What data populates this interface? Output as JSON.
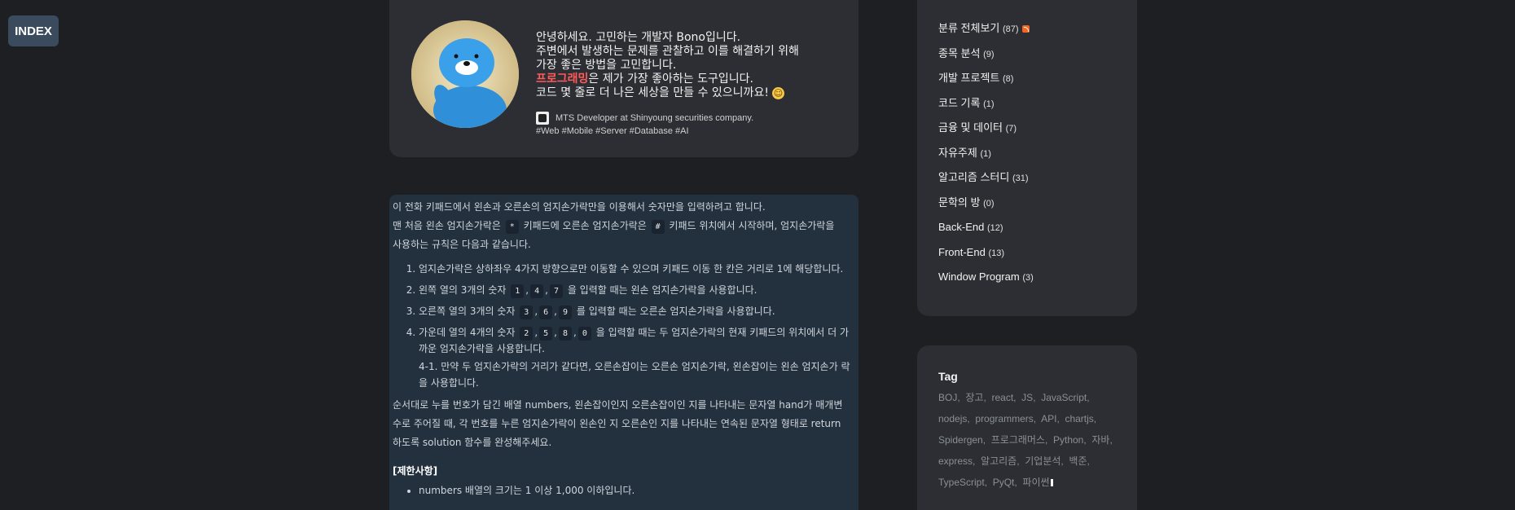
{
  "index_button": "INDEX",
  "profile": {
    "greeting_lines": [
      "안녕하세요. 고민하는 개발자 Bono입니다.",
      "주변에서 발생하는 문제를 관찰하고 이를 해결하기 위해",
      "가장 좋은 방법을 고민합니다."
    ],
    "highlight_word": "프로그래밍",
    "highlight_rest": "은 제가 가장 좋아하는 도구입니다.",
    "last_line": "코드 몇 줄로 더 나은 세상을 만들 수 있으니까요!",
    "emoji": "☺",
    "job": "MTS Developer at Shinyoung securities company.",
    "hashtags": "#Web #Mobile #Server #Database #AI"
  },
  "content": {
    "intro1": "이 전화 키패드에서 왼손과 오른손의 엄지손가락만을 이용해서 숫자만을 입력하려고 합니다.",
    "intro2_a": "맨 처음 왼손 엄지손가락은",
    "intro2_code1": "*",
    "intro2_b": "키패드에 오른손 엄지손가락은",
    "intro2_code2": "#",
    "intro2_c": "키패드 위치에서 시작하며, 엄지손가락을",
    "intro3": "사용하는 규칙은 다음과 같습니다.",
    "rule1": "엄지손가락은 상하좌우 4가지 방향으로만 이동할 수 있으며 키패드 이동 한 칸은 거리로 1에 해당합니다.",
    "rule2_a": "왼쪽 열의 3개의 숫자",
    "rule2_codes": [
      "1",
      "4",
      "7"
    ],
    "rule2_b": "을 입력할 때는 왼손 엄지손가락을 사용합니다.",
    "rule3_a": "오른쪽 열의 3개의 숫자",
    "rule3_codes": [
      "3",
      "6",
      "9"
    ],
    "rule3_b": "를 입력할 때는 오른손 엄지손가락을 사용합니다.",
    "rule4_a": "가운데 열의 4개의 숫자",
    "rule4_codes": [
      "2",
      "5",
      "8",
      "0"
    ],
    "rule4_b": "을 입력할 때는 두 엄지손가락의 현재 키패드의 위치에서 더",
    "rule4_c": "가까운 엄지손가락을 사용합니다.",
    "rule4_sub1": "4-1. 만약 두 엄지손가락의 거리가 같다면, 오른손잡이는 오른손 엄지손가락, 왼손잡이는 왼손 엄지손가",
    "rule4_sub2": "락을 사용합니다.",
    "para2_1": "순서대로 누를 번호가 담긴 배열 numbers, 왼손잡이인지 오른손잡이인 지를 나타내는 문자열 hand가 매개변",
    "para2_2": "수로 주어질 때, 각 번호를 누른 엄지손가락이 왼손인 지 오른손인 지를 나타내는 연속된 문자열 형태로 return",
    "para2_3": "하도록 solution 함수를 완성해주세요.",
    "constraints_title": "[제한사항]",
    "constraint1": "numbers 배열의 크기는 1 이상 1,000 이하입니다."
  },
  "categories": [
    {
      "name": "분류 전체보기",
      "count": "(87)",
      "rss": true
    },
    {
      "name": "종목 분석",
      "count": "(9)"
    },
    {
      "name": "개발 프로젝트",
      "count": "(8)"
    },
    {
      "name": "코드 기록",
      "count": "(1)"
    },
    {
      "name": "금융 및 데이터",
      "count": "(7)"
    },
    {
      "name": "자유주제",
      "count": "(1)"
    },
    {
      "name": "알고리즘 스터디",
      "count": "(31)"
    },
    {
      "name": "문학의 방",
      "count": "(0)"
    },
    {
      "name": "Back-End",
      "count": "(12)"
    },
    {
      "name": "Front-End",
      "count": "(13)"
    },
    {
      "name": "Window Program",
      "count": "(3)"
    }
  ],
  "tag_title": "Tag",
  "tags": [
    "BOJ",
    "장고",
    "react",
    "JS",
    "JavaScript",
    "nodejs",
    "programmers",
    "API",
    "chartjs",
    "Spidergen",
    "프로그래머스",
    "Python",
    "자바",
    "express",
    "알고리즘",
    "기업분석",
    "백준",
    "TypeScript",
    "PyQt",
    "파이썬"
  ],
  "colors": {
    "accent": "#ff5b5b",
    "page_bg": "#1e1f22",
    "card_bg": "#2c2e33",
    "content_bg": "#23303e"
  }
}
